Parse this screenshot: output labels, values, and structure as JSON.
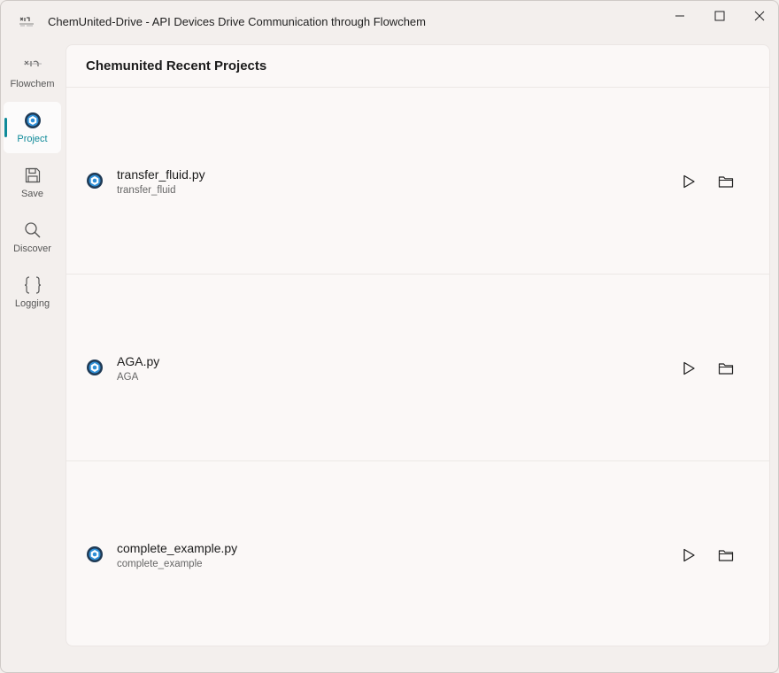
{
  "window": {
    "title": "ChemUnited-Drive - API Devices Drive Communication through Flowchem"
  },
  "sidebar": {
    "items": [
      {
        "label": "Flowchem",
        "icon": "flowchem-icon"
      },
      {
        "label": "Project",
        "icon": "project-icon",
        "active": true
      },
      {
        "label": "Save",
        "icon": "save-icon"
      },
      {
        "label": "Discover",
        "icon": "search-icon"
      },
      {
        "label": "Logging",
        "icon": "braces-icon"
      }
    ]
  },
  "main": {
    "title": "Chemunited Recent Projects",
    "projects": [
      {
        "name": "transfer_fluid.py",
        "subtitle": "transfer_fluid"
      },
      {
        "name": "AGA.py",
        "subtitle": "AGA"
      },
      {
        "name": "complete_example.py",
        "subtitle": "complete_example"
      }
    ]
  },
  "colors": {
    "accent": "#0f8a99",
    "background": "#f3efed",
    "card": "#fbf8f7"
  }
}
